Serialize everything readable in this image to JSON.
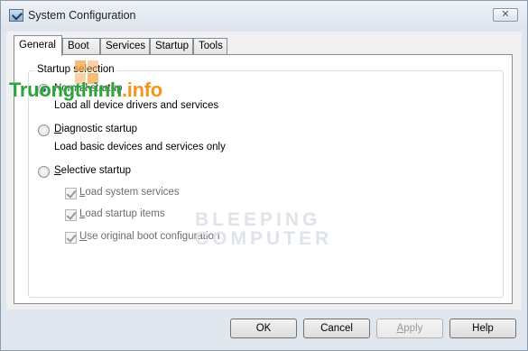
{
  "window": {
    "title": "System Configuration",
    "close_glyph": "✕"
  },
  "tabs": [
    {
      "label": "General",
      "active": true
    },
    {
      "label": "Boot",
      "active": false
    },
    {
      "label": "Services",
      "active": false
    },
    {
      "label": "Startup",
      "active": false
    },
    {
      "label": "Tools",
      "active": false
    }
  ],
  "startup_selection": {
    "legend": "Startup selection",
    "options": [
      {
        "label": "Normal startup",
        "description": "Load all device drivers and services",
        "selected": true
      },
      {
        "label": "Diagnostic startup",
        "description": "Load basic devices and services only",
        "selected": false
      },
      {
        "label": "Selective startup",
        "description": "",
        "selected": false
      }
    ],
    "selective_items": [
      {
        "label": "Load system services",
        "checked": true,
        "enabled": false
      },
      {
        "label": "Load startup items",
        "checked": true,
        "enabled": false
      },
      {
        "label": "Use original boot configuration",
        "checked": true,
        "enabled": false
      }
    ]
  },
  "buttons": {
    "ok": "OK",
    "cancel": "Cancel",
    "apply": "Apply",
    "help": "Help"
  },
  "watermarks": {
    "site_main": "Truongthinh",
    "site_suffix": ".info",
    "bleeping_line1": "BLEEPING",
    "bleeping_line2": "COMPUTER"
  },
  "icons": {
    "app": "msconfig-icon",
    "close": "close-icon"
  },
  "colors": {
    "frame": "#dfe6ee",
    "watermark_green": "#29a539",
    "watermark_orange": "#f7941d"
  }
}
